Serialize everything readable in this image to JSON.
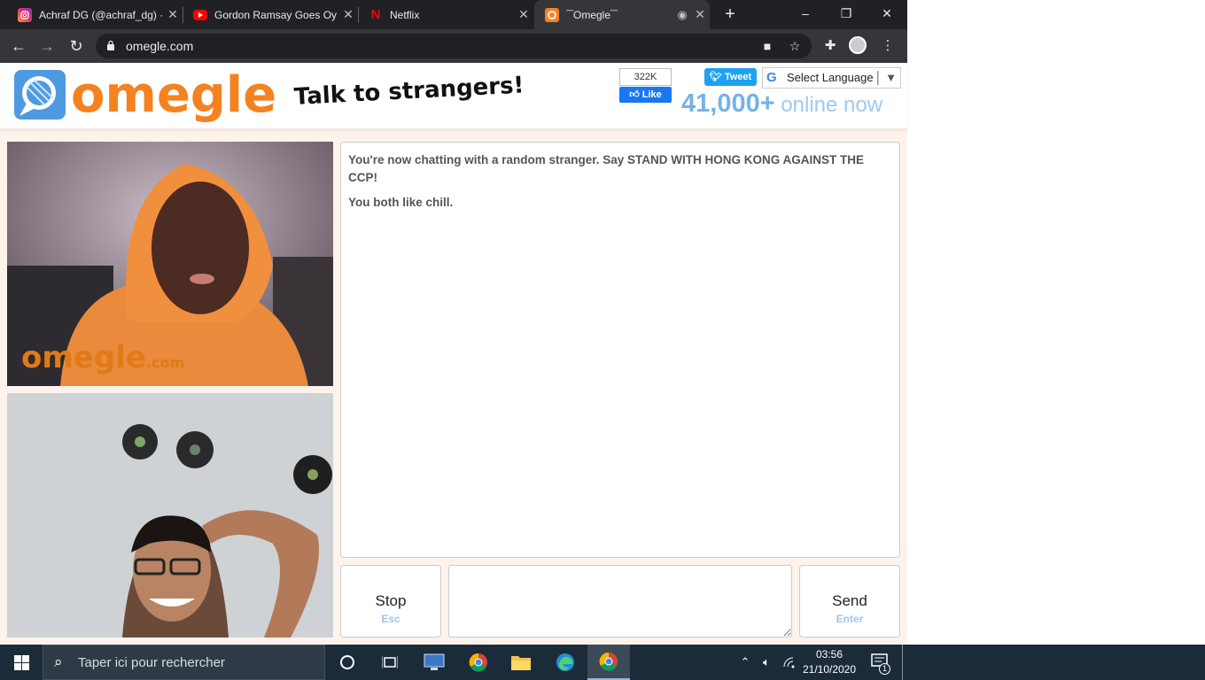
{
  "browser": {
    "tabs": [
      {
        "title": "Achraf DG (@achraf_dg) · ",
        "favicon": "instagram-icon",
        "active": false
      },
      {
        "title": "Gordon Ramsay Goes Oy",
        "favicon": "youtube-icon",
        "active": false
      },
      {
        "title": "Netflix",
        "favicon": "netflix-icon",
        "active": false
      },
      {
        "title": "‾‾Omegle‾‾",
        "favicon": "omegle-icon",
        "active": true
      }
    ],
    "new_tab": "+",
    "url": "omegle.com",
    "window_controls": {
      "minimize": "–",
      "restore": "❐",
      "close": "✕"
    }
  },
  "site": {
    "logo_text": "omegle",
    "tagline": "Talk to strangers!",
    "fb_count": "322K",
    "fb_like": "Like",
    "tweet": "Tweet",
    "language_select": "Select Language",
    "online_count": "41,000+",
    "online_label": "online now",
    "watermark": "omegle",
    "watermark_suffix": ".com"
  },
  "chat": {
    "messages": [
      "You're now chatting with a random stranger. Say STAND WITH HONG KONG AGAINST THE CCP!",
      "You both like chill."
    ],
    "stop_label": "Stop",
    "stop_hint": "Esc",
    "send_label": "Send",
    "send_hint": "Enter",
    "message_value": ""
  },
  "taskbar": {
    "search_placeholder": "Taper ici pour rechercher",
    "time": "03:56",
    "date": "21/10/2020",
    "notification_count": "1"
  },
  "colors": {
    "omegle_orange": "#f58220",
    "omegle_blue": "#4d9ae0",
    "page_bg": "#fdf3ec",
    "chrome_dark": "#202124",
    "taskbar": "#1c2b3a"
  }
}
